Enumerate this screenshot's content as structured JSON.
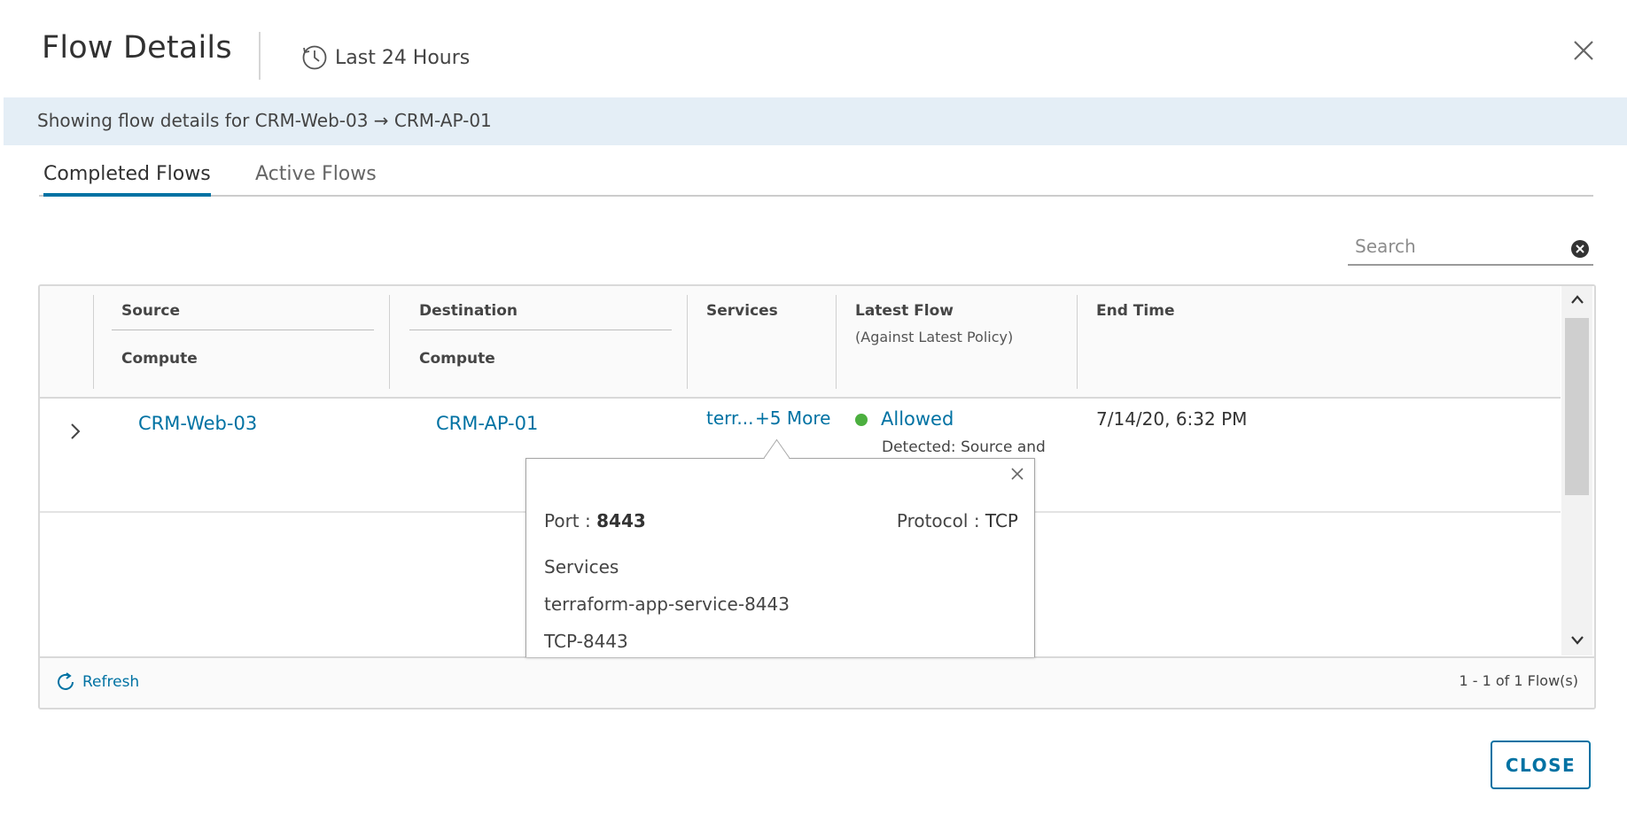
{
  "dialog": {
    "title": "Flow Details",
    "time_range": "Last 24 Hours",
    "close_button": "CLOSE"
  },
  "banner": {
    "text": "Showing flow details for CRM-Web-03 → CRM-AP-01"
  },
  "tabs": [
    {
      "label": "Completed Flows",
      "active": true
    },
    {
      "label": "Active Flows",
      "active": false
    }
  ],
  "search": {
    "placeholder": "Search",
    "value": ""
  },
  "table": {
    "headers": {
      "source": "Source",
      "source_sub": "Compute",
      "destination": "Destination",
      "destination_sub": "Compute",
      "services": "Services",
      "latest_flow": "Latest Flow",
      "latest_flow_sub": "(Against Latest Policy)",
      "end_time": "End Time"
    },
    "rows": [
      {
        "source": "CRM-Web-03",
        "destination": "CRM-AP-01",
        "service_short": "terr...",
        "service_more": "+5 More",
        "status": "Allowed",
        "status_color": "#4caf3f",
        "detected": "Detected: Source and",
        "end_time": "7/14/20, 6:32 PM"
      }
    ],
    "footer": {
      "refresh": "Refresh",
      "count": "1 - 1 of 1 Flow(s)"
    }
  },
  "popover": {
    "port_label": "Port : ",
    "port_value": "8443",
    "protocol_label": "Protocol : ",
    "protocol_value": "TCP",
    "services_label": "Services",
    "services": [
      "terraform-app-service-8443",
      "TCP-8443"
    ]
  },
  "colors": {
    "accent": "#0072a3",
    "banner_bg": "#e4eef6",
    "allowed": "#4caf3f"
  }
}
